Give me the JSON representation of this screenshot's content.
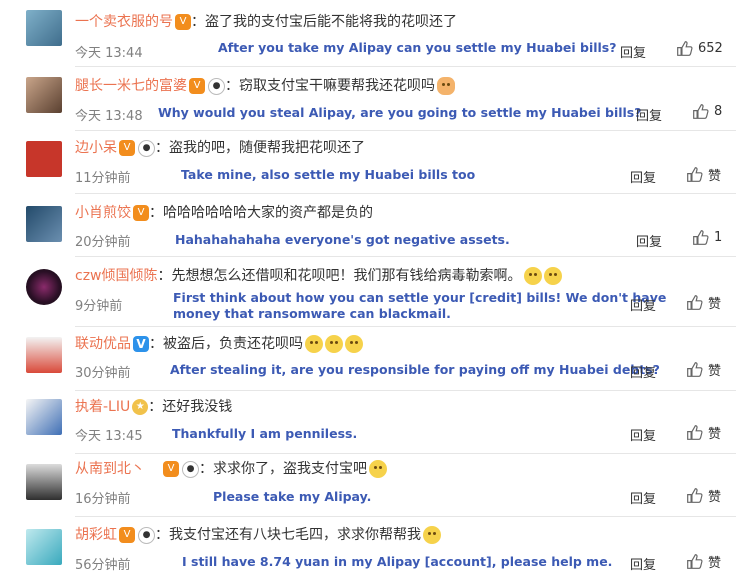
{
  "actions": {
    "reply_label": "回复",
    "like_default": "赞"
  },
  "comments": [
    {
      "user": "一个卖衣服的号",
      "text": "：盗了我的支付宝后能不能将我的花呗还了",
      "time": "今天 13:44",
      "translation": "After you take my Alipay can you settle my Huabei bills?",
      "likes": "652"
    },
    {
      "user": "腿长一米七的富婆",
      "text": "：窃取支付宝干嘛要帮我还花呗吗",
      "time": "今天 13:48",
      "translation": "Why would you steal Alipay, are you going to settle my Huabei bills?",
      "likes": "8"
    },
    {
      "user": "边小呆",
      "text": "：盗我的吧，随便帮我把花呗还了",
      "time": "11分钟前",
      "translation": "Take mine, also settle my Huabei bills too",
      "likes": "赞"
    },
    {
      "user": "小肖煎饺",
      "text": "：哈哈哈哈哈哈大家的资产都是负的",
      "time": "20分钟前",
      "translation": "Hahahahahaha everyone's got negative assets.",
      "likes": "1"
    },
    {
      "user": "czw倾国倾陈",
      "text": "：先想想怎么还借呗和花呗吧！我们那有钱给病毒勒索啊。",
      "time": "9分钟前",
      "translation": "First think about how you can settle your [credit] bills! We don't have",
      "translation2": "money that ransomware can blackmail.",
      "likes": "赞"
    },
    {
      "user": "联动优品",
      "text": "：被盗后，负责还花呗吗",
      "time": "30分钟前",
      "translation": "After stealing it, are you responsible for paying off my Huabei debts?",
      "likes": "赞"
    },
    {
      "user": "执着-LIU",
      "text": "：还好我没钱",
      "time": "今天 13:45",
      "translation": "Thankfully I am penniless.",
      "likes": "赞"
    },
    {
      "user": "从南到北丶",
      "text": "：求求你了，盗我支付宝吧",
      "time": "16分钟前",
      "translation": "Please take my Alipay.",
      "likes": "赞"
    },
    {
      "user": "胡彩虹",
      "text": "：我支付宝还有八块七毛四，求求你帮帮我",
      "time": "56分钟前",
      "translation": "I still have 8.74 yuan in my Alipay [account], please help me.",
      "likes": "赞"
    }
  ],
  "colors": {
    "username": "#eb7350",
    "translation": "#3c5ab4",
    "time": "#808080"
  }
}
